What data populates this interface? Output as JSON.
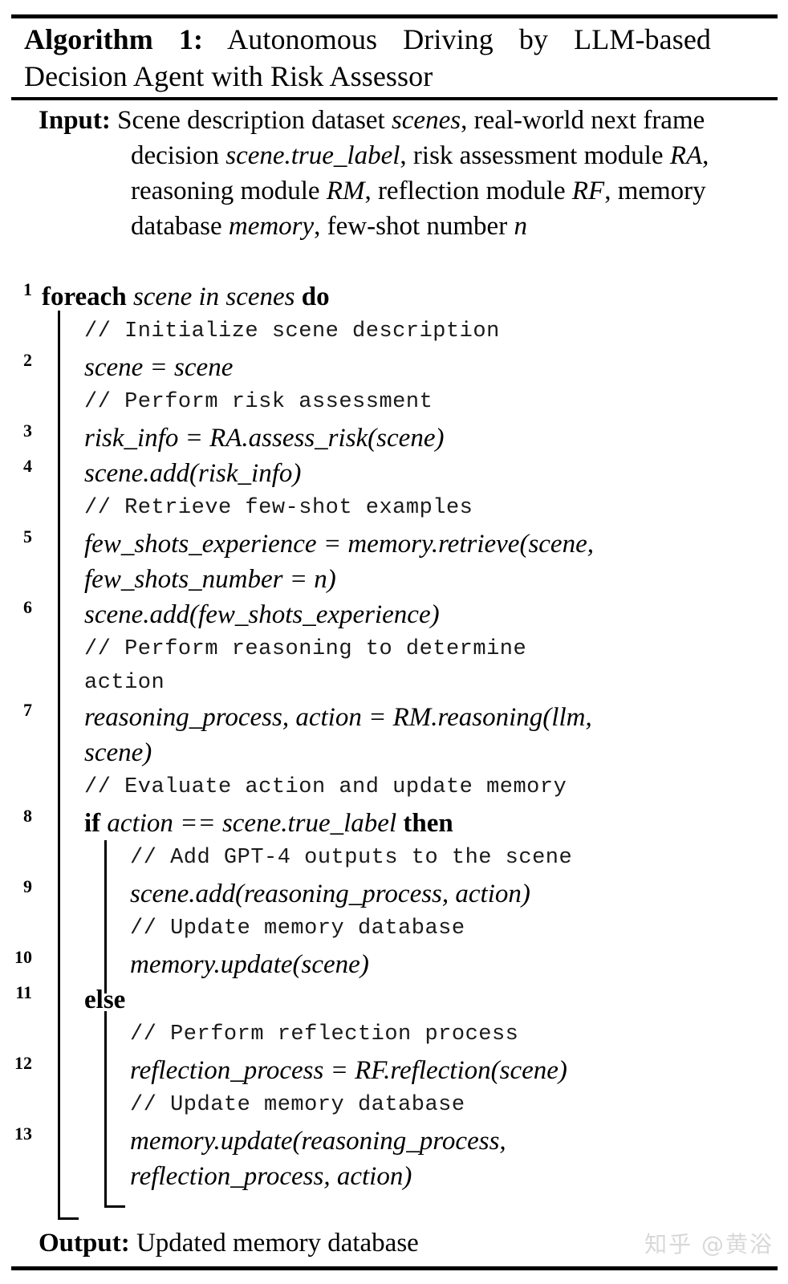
{
  "algorithm": {
    "title_prefix": "Algorithm 1:",
    "title_rest": " Autonomous Driving by LLM-based Decision Agent with Risk Assessor",
    "input_label": "Input:",
    "input_text_1": " Scene description dataset ",
    "input_var_1": "scenes",
    "input_text_2": ", real-world next frame decision ",
    "input_var_2": "scene.true_label",
    "input_text_3": ", risk assessment module ",
    "input_var_3": "RA",
    "input_text_4": ", reasoning module ",
    "input_var_4": "RM",
    "input_text_5": ", reflection module ",
    "input_var_5": "RF",
    "input_text_6": ", memory database ",
    "input_var_6": "memory",
    "input_text_7": ", few-shot number ",
    "input_var_7": "n",
    "output_label": "Output:",
    "output_text": " Updated memory database"
  },
  "body": {
    "line1": {
      "num": "1",
      "kw1": "foreach",
      "mid": " scene in scenes ",
      "kw2": "do"
    },
    "comment1": "// Initialize scene description",
    "line2": {
      "num": "2",
      "code": "scene = scene"
    },
    "comment2": "// Perform risk assessment",
    "line3": {
      "num": "3",
      "code": "risk_info = RA.assess_risk(scene)"
    },
    "line4": {
      "num": "4",
      "code": "scene.add(risk_info)"
    },
    "comment3": "// Retrieve few-shot examples",
    "line5": {
      "num": "5",
      "code": "few_shots_experience = memory.retrieve(scene,",
      "cont": "few_shots_number = n)"
    },
    "line6": {
      "num": "6",
      "code": "scene.add(few_shots_experience)"
    },
    "comment4": "// Perform reasoning to determine",
    "comment4_cont": "action",
    "line7": {
      "num": "7",
      "code": "reasoning_process, action = RM.reasoning(llm,",
      "cont": "scene)"
    },
    "comment5": "// Evaluate action and update memory",
    "line8": {
      "num": "8",
      "kw1": "if",
      "mid": " action == scene.true_label ",
      "kw2": "then"
    },
    "comment6": "// Add GPT-4 outputs to the scene",
    "line9": {
      "num": "9",
      "code": "scene.add(reasoning_process, action)"
    },
    "comment7": "// Update memory database",
    "line10": {
      "num": "10",
      "code": "memory.update(scene)"
    },
    "line11": {
      "num": "11",
      "kw1": "else"
    },
    "comment8": "// Perform reflection process",
    "line12": {
      "num": "12",
      "code": "reflection_process = RF.reflection(scene)"
    },
    "comment9": "// Update memory database",
    "line13": {
      "num": "13",
      "code": "memory.update(reasoning_process,",
      "cont": "reflection_process, action)"
    }
  },
  "watermark": {
    "text": "知乎 @黄浴"
  }
}
